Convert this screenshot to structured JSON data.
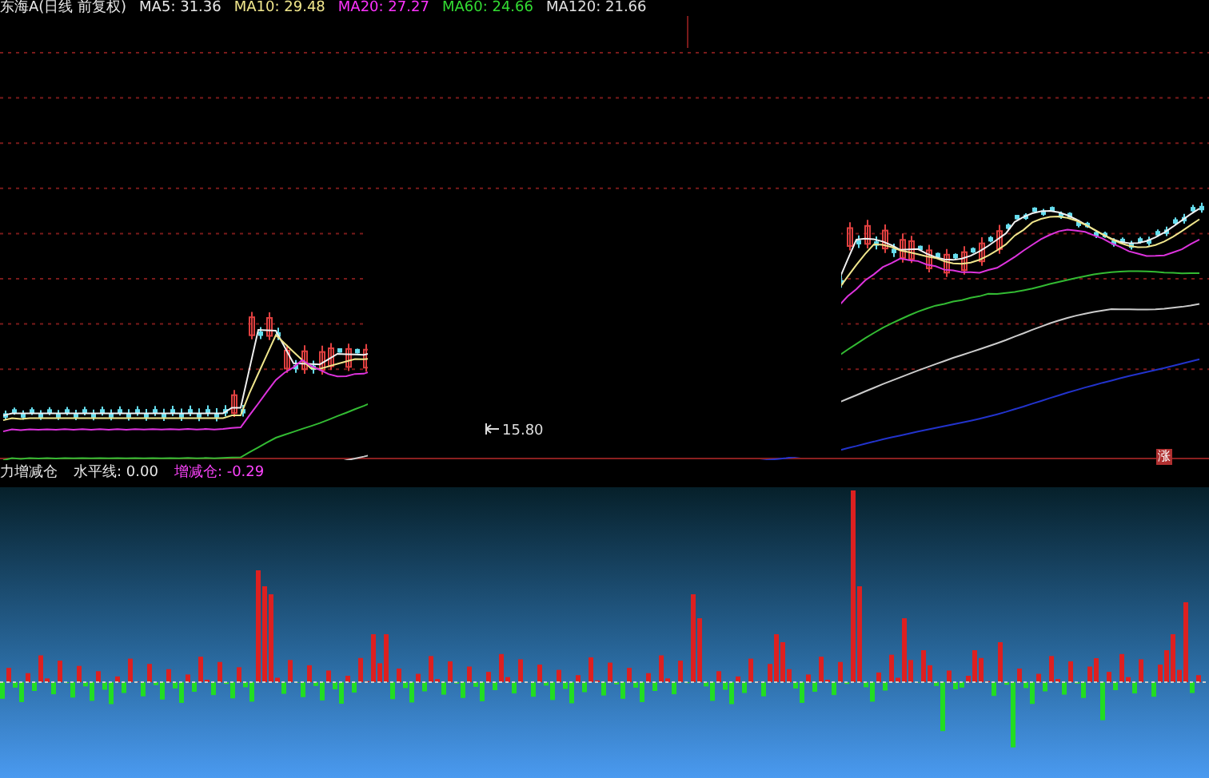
{
  "header": {
    "title": "东海A(日线 前复权)",
    "ma": [
      {
        "label": "MA5: 31.36",
        "color": "#e8e8e8"
      },
      {
        "label": "MA10: 29.48",
        "color": "#f0e68c"
      },
      {
        "label": "MA20: 27.27",
        "color": "#ff33ff"
      },
      {
        "label": "MA60: 24.66",
        "color": "#33dd33"
      },
      {
        "label": "MA120: 21.66",
        "color": "#e0e0e0"
      }
    ]
  },
  "main_chart": {
    "price_marker": "15.80",
    "badge": "涨"
  },
  "indicator": {
    "name": "力增减仓",
    "items": [
      {
        "label": "水平线: 0.00",
        "color": "#e8e8e8"
      },
      {
        "label": "增减仓: -0.29",
        "color": "#ff44ff"
      }
    ]
  }
}
